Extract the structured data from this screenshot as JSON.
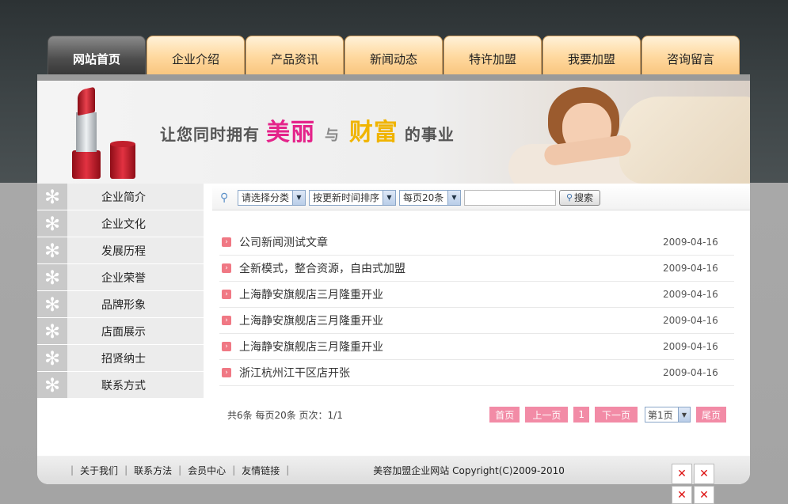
{
  "nav": {
    "tabs": [
      {
        "label": "网站首页",
        "active": true
      },
      {
        "label": "企业介绍",
        "active": false
      },
      {
        "label": "产品资讯",
        "active": false
      },
      {
        "label": "新闻动态",
        "active": false
      },
      {
        "label": "特许加盟",
        "active": false
      },
      {
        "label": "我要加盟",
        "active": false
      },
      {
        "label": "咨询留言",
        "active": false
      }
    ]
  },
  "banner": {
    "slogan_prefix": "让您同时拥有",
    "slogan_word1": "美丽",
    "slogan_mid": "与",
    "slogan_word2": "财富",
    "slogan_suffix": "的事业"
  },
  "sidebar": {
    "items": [
      {
        "label": "企业简介",
        "icon": "flower-icon"
      },
      {
        "label": "企业文化",
        "icon": "flower-icon"
      },
      {
        "label": "发展历程",
        "icon": "flower-icon"
      },
      {
        "label": "企业荣誉",
        "icon": "flower-icon"
      },
      {
        "label": "品牌形象",
        "icon": "flower-icon"
      },
      {
        "label": "店面展示",
        "icon": "flower-icon"
      },
      {
        "label": "招贤纳士",
        "icon": "flower-icon"
      },
      {
        "label": "联系方式",
        "icon": "flower-icon"
      }
    ]
  },
  "search": {
    "category": "请选择分类",
    "sort": "按更新时间排序",
    "per_page": "每页20条",
    "keyword": "",
    "button": "搜索"
  },
  "news": {
    "rows": [
      {
        "title": "公司新闻测试文章",
        "date": "2009-04-16"
      },
      {
        "title": "全新模式，整合资源，自由式加盟",
        "date": "2009-04-16"
      },
      {
        "title": "上海静安旗舰店三月隆重开业",
        "date": "2009-04-16"
      },
      {
        "title": "上海静安旗舰店三月隆重开业",
        "date": "2009-04-16"
      },
      {
        "title": "上海静安旗舰店三月隆重开业",
        "date": "2009-04-16"
      },
      {
        "title": "浙江杭州江干区店开张",
        "date": "2009-04-16"
      }
    ]
  },
  "pager": {
    "info": "共6条  每页20条  页次：1/1",
    "first": "首页",
    "prev": "上一页",
    "current": "1",
    "next": "下一页",
    "select": "第1页",
    "last": "尾页"
  },
  "footer": {
    "links": [
      "关于我们",
      "联系方法",
      "会员中心",
      "友情链接"
    ],
    "copyright": "美容加盟企业网站  Copyright(C)2009-2010"
  },
  "colors": {
    "accent_pink": "#f28ba6",
    "bullet": "#f07884",
    "tab_orange": "#ffd9a0",
    "tab_active": "#4e4e4e"
  }
}
